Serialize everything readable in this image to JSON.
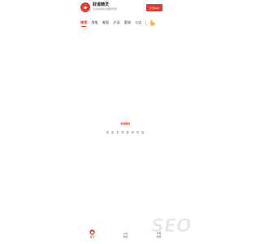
{
  "brand": {
    "name": "财道精灵",
    "slogan": "您身边的投资理财管家",
    "logo_icon": "fox-logo-icon",
    "accent_color": "#e63a2e"
  },
  "header": {
    "open_app_label": "打开APP"
  },
  "tabs": [
    {
      "label": "推荐",
      "active": true
    },
    {
      "label": "港股",
      "active": false
    },
    {
      "label": "美股",
      "active": false
    },
    {
      "label": "沪深",
      "active": false
    },
    {
      "label": "要闻",
      "active": false
    },
    {
      "label": "公告",
      "active": false
    }
  ],
  "tab_extra_icon": "hand-point-icon",
  "empty_state": {
    "logo_text": "财道精灵",
    "message": "暂 无 文 章 发 布 内 容"
  },
  "bottom_nav": [
    {
      "label": "首页",
      "icon": "home-icon",
      "active": true
    },
    {
      "label": "精选",
      "icon": "star-icon",
      "active": false
    },
    {
      "label": "搜索",
      "icon": "search-icon",
      "active": false
    }
  ],
  "watermark": {
    "text": "链发发SEO"
  }
}
